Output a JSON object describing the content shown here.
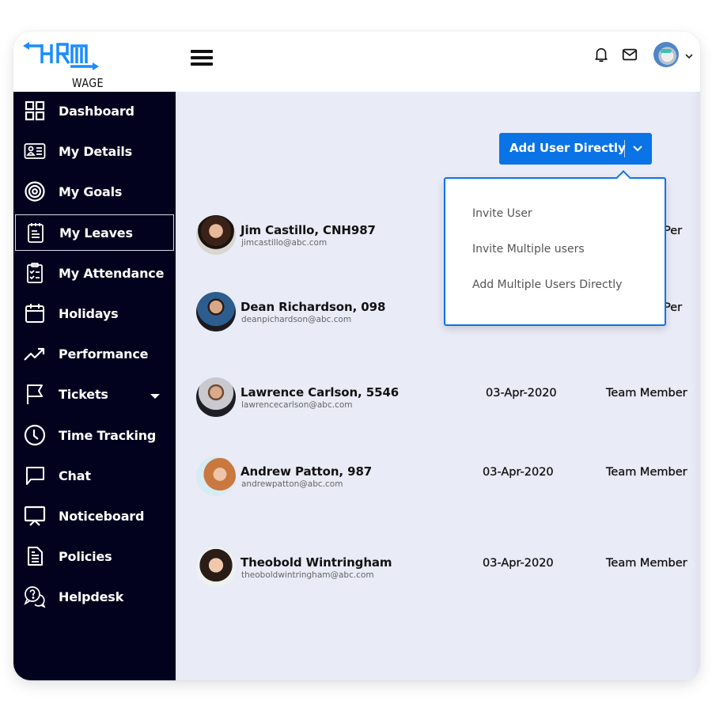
{
  "app": {
    "logo_text": "HRM",
    "logo_subtext": "WAGE",
    "brand_color": "#1a8cff"
  },
  "header": {
    "menu_icon": "hamburger-icon",
    "notification_icon": "bell-icon",
    "mail_icon": "mail-icon",
    "profile_icon": "avatar",
    "profile_caret_icon": "chevron-down-icon"
  },
  "sidebar": {
    "items": [
      {
        "label": "Dashboard",
        "icon": "dashboard-grid-icon"
      },
      {
        "label": "My Details",
        "icon": "id-card-icon"
      },
      {
        "label": "My Goals",
        "icon": "target-icon"
      },
      {
        "label": "My Leaves",
        "icon": "notepad-icon",
        "active": true
      },
      {
        "label": "My Attendance",
        "icon": "clipboard-check-icon"
      },
      {
        "label": "Holidays",
        "icon": "calendar-icon"
      },
      {
        "label": "Performance",
        "icon": "trending-up-icon"
      },
      {
        "label": "Tickets",
        "icon": "flag-icon",
        "has_submenu": true
      },
      {
        "label": "Time Tracking",
        "icon": "clock-icon"
      },
      {
        "label": "Chat",
        "icon": "chat-bubble-icon"
      },
      {
        "label": "Noticeboard",
        "icon": "presentation-board-icon"
      },
      {
        "label": "Policies",
        "icon": "document-icon"
      },
      {
        "label": "Helpdesk",
        "icon": "help-chat-icon"
      }
    ]
  },
  "toolbar": {
    "add_user_label": "Add User Directly",
    "add_user_color": "#0a73e6"
  },
  "dropdown": {
    "items": [
      "Invite User",
      "Invite Multiple users",
      "Add Multiple Users Directly"
    ]
  },
  "users": [
    {
      "name": "Jim Castillo, CNH987",
      "email": "jimcastillo@abc.com",
      "date": "",
      "role": "Per"
    },
    {
      "name": "Dean Richardson, 098",
      "email": "deanpichardson@abc.com",
      "date": "",
      "role": "Per"
    },
    {
      "name": "Lawrence Carlson, 5546",
      "email": "lawrencecarlson@abc.com",
      "date": "03-Apr-2020",
      "role": "Team Member"
    },
    {
      "name": "Andrew Patton, 987",
      "email": "andrewpatton@abc.com",
      "date": "03-Apr-2020",
      "role": "Team Member"
    },
    {
      "name": "Theobold Wintringham",
      "email": "theoboldwintringham@abc.com",
      "date": "03-Apr-2020",
      "role": "Team Member"
    }
  ]
}
